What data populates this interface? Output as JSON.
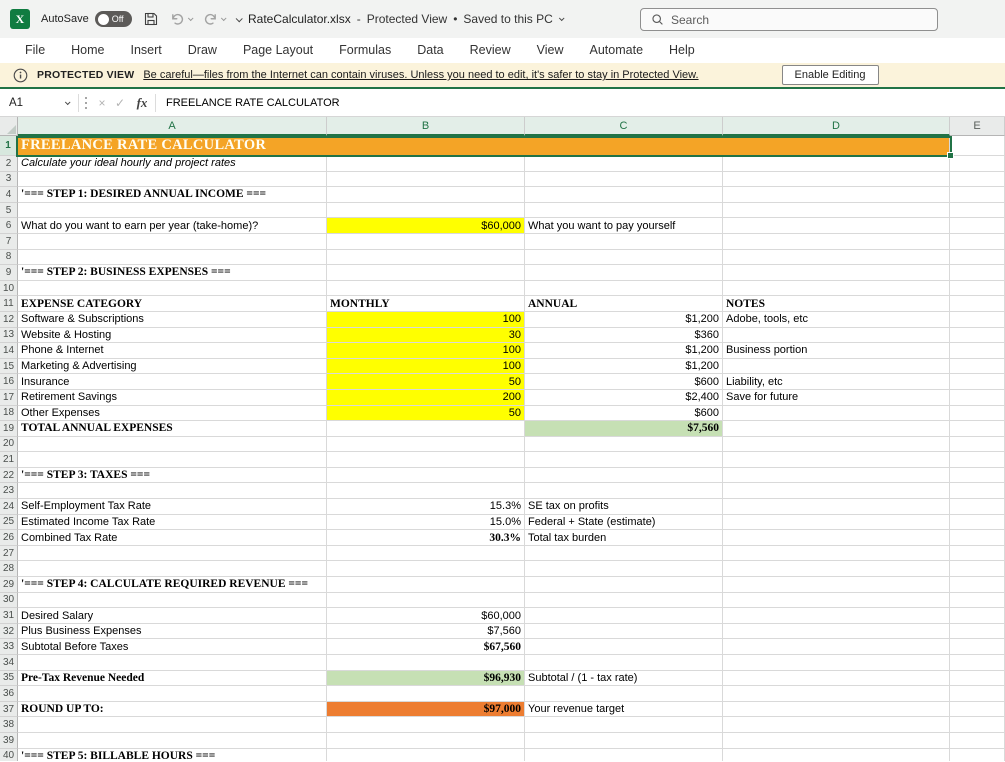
{
  "colors": {
    "accent_green": "#217346",
    "input_fill": "#FFFF00",
    "result_fill": "#C6E0B4",
    "target_fill": "#ED7D31",
    "title_fill": "#F4A426",
    "banner_bg": "#FBF3DB"
  },
  "title_bar": {
    "autosave_label": "AutoSave",
    "autosave_state": "Off",
    "file_name": "RateCalculator.xlsx",
    "dash": "-",
    "mode": "Protected View",
    "bullet": "•",
    "saved_status": "Saved to this PC",
    "search_placeholder": "Search"
  },
  "menu": {
    "tabs": [
      "File",
      "Home",
      "Insert",
      "Draw",
      "Page Layout",
      "Formulas",
      "Data",
      "Review",
      "View",
      "Automate",
      "Help"
    ]
  },
  "message_bar": {
    "label": "PROTECTED VIEW",
    "message": "Be careful—files from the Internet can contain viruses. Unless you need to edit, it's safer to stay in Protected View.",
    "button_label": "Enable Editing"
  },
  "formula_bar": {
    "name_box": "A1",
    "cancel_glyph": "×",
    "confirm_glyph": "✓",
    "fx_label": "fx",
    "content": "FREELANCE RATE CALCULATOR"
  },
  "sheet": {
    "columns": [
      "A",
      "B",
      "C",
      "D",
      "E"
    ],
    "selected_range": "A1:D1",
    "rows": [
      {
        "n": 1,
        "cells": {
          "A": {
            "text": "FREELANCE RATE CALCULATOR",
            "span": 4,
            "cls": "title-cell"
          }
        }
      },
      {
        "n": 2,
        "cells": {
          "A": {
            "text": "Calculate your ideal hourly and project rates",
            "italic": true
          }
        }
      },
      {
        "n": 4,
        "cells": {
          "A": {
            "text": "'=== STEP 1: DESIRED ANNUAL INCOME ===",
            "bold": true
          }
        }
      },
      {
        "n": 6,
        "cells": {
          "A": {
            "text": "What do you want to earn per year (take-home)?"
          },
          "B": {
            "text": "$60,000",
            "bg": "yellow",
            "align": "right"
          },
          "C": {
            "text": "What you want to pay yourself"
          }
        }
      },
      {
        "n": 9,
        "cells": {
          "A": {
            "text": "'=== STEP 2: BUSINESS EXPENSES ===",
            "bold": true
          }
        }
      },
      {
        "n": 11,
        "cells": {
          "A": {
            "text": "EXPENSE CATEGORY",
            "bold": true
          },
          "B": {
            "text": "MONTHLY",
            "bold": true
          },
          "C": {
            "text": "ANNUAL",
            "bold": true
          },
          "D": {
            "text": "NOTES",
            "bold": true
          }
        }
      },
      {
        "n": 12,
        "cells": {
          "A": {
            "text": "Software & Subscriptions"
          },
          "B": {
            "text": "100",
            "bg": "yellow",
            "align": "right"
          },
          "C": {
            "text": "$1,200",
            "align": "right"
          },
          "D": {
            "text": "Adobe, tools, etc"
          }
        }
      },
      {
        "n": 13,
        "cells": {
          "A": {
            "text": "Website & Hosting"
          },
          "B": {
            "text": "30",
            "bg": "yellow",
            "align": "right"
          },
          "C": {
            "text": "$360",
            "align": "right"
          }
        }
      },
      {
        "n": 14,
        "cells": {
          "A": {
            "text": "Phone & Internet"
          },
          "B": {
            "text": "100",
            "bg": "yellow",
            "align": "right"
          },
          "C": {
            "text": "$1,200",
            "align": "right"
          },
          "D": {
            "text": "Business portion"
          }
        }
      },
      {
        "n": 15,
        "cells": {
          "A": {
            "text": "Marketing & Advertising"
          },
          "B": {
            "text": "100",
            "bg": "yellow",
            "align": "right"
          },
          "C": {
            "text": "$1,200",
            "align": "right"
          }
        }
      },
      {
        "n": 16,
        "cells": {
          "A": {
            "text": "Insurance"
          },
          "B": {
            "text": "50",
            "bg": "yellow",
            "align": "right"
          },
          "C": {
            "text": "$600",
            "align": "right"
          },
          "D": {
            "text": "Liability, etc"
          }
        }
      },
      {
        "n": 17,
        "cells": {
          "A": {
            "text": "Retirement Savings"
          },
          "B": {
            "text": "200",
            "bg": "yellow",
            "align": "right"
          },
          "C": {
            "text": "$2,400",
            "align": "right"
          },
          "D": {
            "text": "Save for future"
          }
        }
      },
      {
        "n": 18,
        "cells": {
          "A": {
            "text": "Other Expenses"
          },
          "B": {
            "text": "50",
            "bg": "yellow",
            "align": "right"
          },
          "C": {
            "text": "$600",
            "align": "right"
          }
        }
      },
      {
        "n": 19,
        "cells": {
          "A": {
            "text": "TOTAL ANNUAL EXPENSES",
            "bold": true
          },
          "C": {
            "text": "$7,560",
            "bold": true,
            "bg": "green",
            "align": "right"
          }
        }
      },
      {
        "n": 22,
        "cells": {
          "A": {
            "text": "'=== STEP 3: TAXES ===",
            "bold": true
          }
        }
      },
      {
        "n": 24,
        "cells": {
          "A": {
            "text": "Self-Employment Tax Rate"
          },
          "B": {
            "text": "15.3%",
            "align": "right"
          },
          "C": {
            "text": "SE tax on profits"
          }
        }
      },
      {
        "n": 25,
        "cells": {
          "A": {
            "text": "Estimated Income Tax Rate"
          },
          "B": {
            "text": "15.0%",
            "align": "right"
          },
          "C": {
            "text": "Federal + State (estimate)"
          }
        }
      },
      {
        "n": 26,
        "cells": {
          "A": {
            "text": "Combined Tax Rate"
          },
          "B": {
            "text": "30.3%",
            "bold": true,
            "align": "right"
          },
          "C": {
            "text": "Total tax burden"
          }
        }
      },
      {
        "n": 29,
        "cells": {
          "A": {
            "text": "'=== STEP 4: CALCULATE REQUIRED REVENUE ===",
            "bold": true
          }
        }
      },
      {
        "n": 31,
        "cells": {
          "A": {
            "text": "Desired Salary"
          },
          "B": {
            "text": "$60,000",
            "align": "right"
          }
        }
      },
      {
        "n": 32,
        "cells": {
          "A": {
            "text": "Plus Business Expenses"
          },
          "B": {
            "text": "$7,560",
            "align": "right"
          }
        }
      },
      {
        "n": 33,
        "cells": {
          "A": {
            "text": "Subtotal Before Taxes"
          },
          "B": {
            "text": "$67,560",
            "bold": true,
            "align": "right"
          }
        }
      },
      {
        "n": 35,
        "cells": {
          "A": {
            "text": "Pre-Tax Revenue Needed",
            "bold": true
          },
          "B": {
            "text": "$96,930",
            "bold": true,
            "bg": "green",
            "align": "right"
          },
          "C": {
            "text": "Subtotal / (1 - tax rate)"
          }
        }
      },
      {
        "n": 37,
        "cells": {
          "A": {
            "text": "ROUND UP TO:",
            "bold": true
          },
          "B": {
            "text": "$97,000",
            "bold": true,
            "bg": "orange",
            "align": "right"
          },
          "C": {
            "text": "Your revenue target"
          }
        }
      },
      {
        "n": 40,
        "cells": {
          "A": {
            "text": "'=== STEP 5: BILLABLE HOURS ===",
            "bold": true
          }
        }
      }
    ]
  }
}
